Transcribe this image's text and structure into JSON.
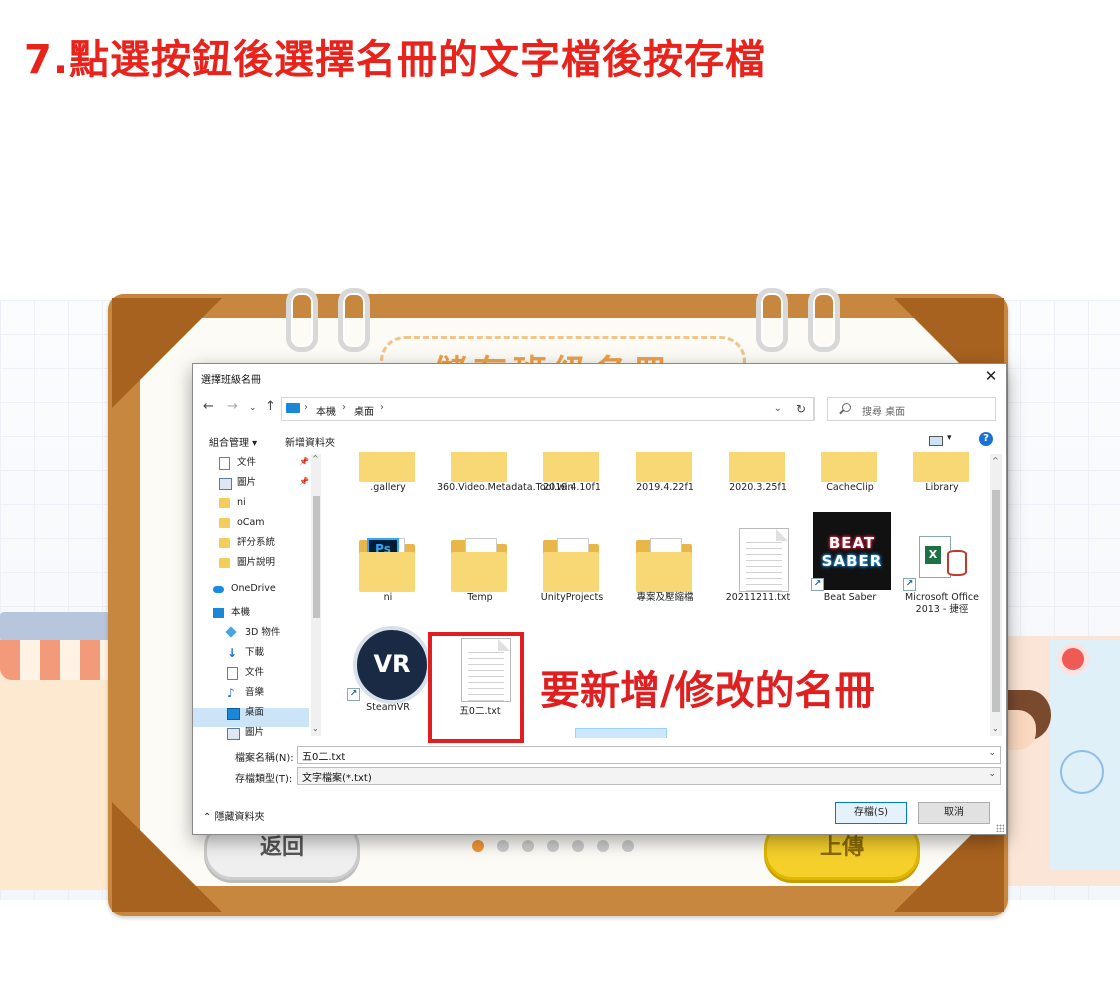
{
  "step_title": "7.點選按鈕後選擇名冊的文字檔後按存檔",
  "board": {
    "title": "儲存班級名冊",
    "back_label": "返回",
    "upload_label": "上傳",
    "page_dots": 7,
    "active_dot": 0
  },
  "dialog": {
    "title": "選擇班級名冊",
    "close": "✕",
    "address": [
      "本機",
      "桌面"
    ],
    "search_placeholder": "搜尋 桌面",
    "organize": "組合管理 ▾",
    "new_folder": "新增資料夾",
    "help": "?",
    "nav_items": [
      {
        "label": "文件",
        "icon": "document-icon",
        "pinned": true
      },
      {
        "label": "圖片",
        "icon": "pictures-icon",
        "pinned": true
      },
      {
        "label": "ni",
        "icon": "folder-icon",
        "pinned": false
      },
      {
        "label": "oCam",
        "icon": "folder-icon",
        "pinned": false
      },
      {
        "label": "評分系統",
        "icon": "folder-icon",
        "pinned": false
      },
      {
        "label": "圖片說明",
        "icon": "folder-icon",
        "pinned": false
      },
      {
        "label": "OneDrive",
        "icon": "cloud-icon",
        "pinned": false
      },
      {
        "label": "本機",
        "icon": "computer-icon",
        "pinned": false
      },
      {
        "label": "3D 物件",
        "icon": "cube-icon",
        "pinned": false
      },
      {
        "label": "下載",
        "icon": "download-icon",
        "pinned": false
      },
      {
        "label": "文件",
        "icon": "document-icon",
        "pinned": false
      },
      {
        "label": "音樂",
        "icon": "music-icon",
        "pinned": false
      },
      {
        "label": "桌面",
        "icon": "desktop-icon",
        "pinned": false,
        "selected": true
      },
      {
        "label": "圖片",
        "icon": "pictures-icon",
        "pinned": false
      }
    ],
    "files": [
      {
        "name": ".gallery",
        "kind": "folder"
      },
      {
        "name": "360.Video.Metadata.Tool.win",
        "kind": "folder-app"
      },
      {
        "name": "2019.4.10f1",
        "kind": "folder-vs"
      },
      {
        "name": "2019.4.22f1",
        "kind": "folder-vs"
      },
      {
        "name": "2020.3.25f1",
        "kind": "folder-vs"
      },
      {
        "name": "CacheClip",
        "kind": "folder"
      },
      {
        "name": "Library",
        "kind": "folder"
      },
      {
        "name": "ni",
        "kind": "folder-ps"
      },
      {
        "name": "Temp",
        "kind": "folder-plain"
      },
      {
        "name": "UnityProjects",
        "kind": "folder"
      },
      {
        "name": "專案及壓縮檔",
        "kind": "folder"
      },
      {
        "name": "20211211.txt",
        "kind": "txt"
      },
      {
        "name": "Beat Saber",
        "kind": "beat-saber"
      },
      {
        "name": "Microsoft Office 2013 - 捷徑",
        "kind": "office-shortcut"
      },
      {
        "name": "SteamVR",
        "kind": "steamvr"
      },
      {
        "name": "五0二.txt",
        "kind": "txt",
        "selected": true
      }
    ],
    "beat_saber_text": [
      "BEAT",
      "SABER"
    ],
    "ps_text": "Ps",
    "vr_text": "VR",
    "excel_text": "X",
    "shortcut_arrow": "↗",
    "filename_label": "檔案名稱(N):",
    "filename_value": "五0二.txt",
    "filetype_label": "存檔類型(T):",
    "filetype_value": "文字檔案(*.txt)",
    "hide_folders": "⌃ 隱藏資料夾",
    "save_button": "存檔(S)",
    "cancel_button": "取消"
  },
  "annotation": "要新增/修改的名冊"
}
